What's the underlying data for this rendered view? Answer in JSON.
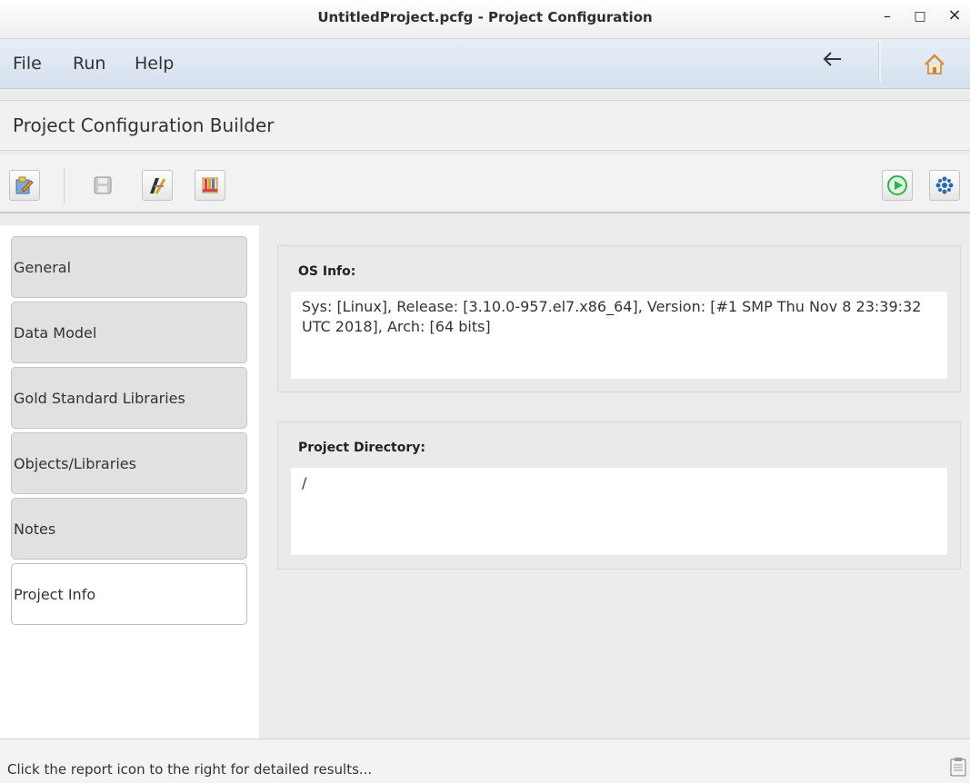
{
  "window": {
    "title": "UntitledProject.pcfg - Project Configuration",
    "controls": {
      "minimize": "–",
      "maximize": "□",
      "close": "×"
    }
  },
  "menubar": {
    "items": [
      "File",
      "Run",
      "Help"
    ],
    "back_icon": "arrow-left-icon",
    "home_icon": "home-icon"
  },
  "page": {
    "title": "Project Configuration Builder"
  },
  "toolbar": {
    "left_icons": [
      "edit-icon",
      "save-icon",
      "edit-tool-icon",
      "library-icon"
    ],
    "right_icons": [
      "run-icon",
      "settings-icon"
    ]
  },
  "sidebar": {
    "tabs": [
      "General",
      "Data Model",
      "Gold Standard Libraries",
      "Objects/Libraries",
      "Notes",
      "Project Info"
    ],
    "active": "Project Info"
  },
  "main": {
    "os_info": {
      "label": "OS Info:",
      "value": "Sys: [Linux], Release: [3.10.0-957.el7.x86_64], Version: [#1 SMP Thu Nov 8 23:39:32 UTC 2018], Arch: [64 bits]"
    },
    "project_directory": {
      "label": "Project Directory:",
      "value": "/"
    }
  },
  "status": {
    "text": "Click the report icon to the right for detailed results...",
    "report_icon": "report-icon"
  },
  "colors": {
    "menubar_bg": "#dce6f1",
    "run_green": "#2fb34a",
    "settings_blue": "#2b6cb0"
  }
}
